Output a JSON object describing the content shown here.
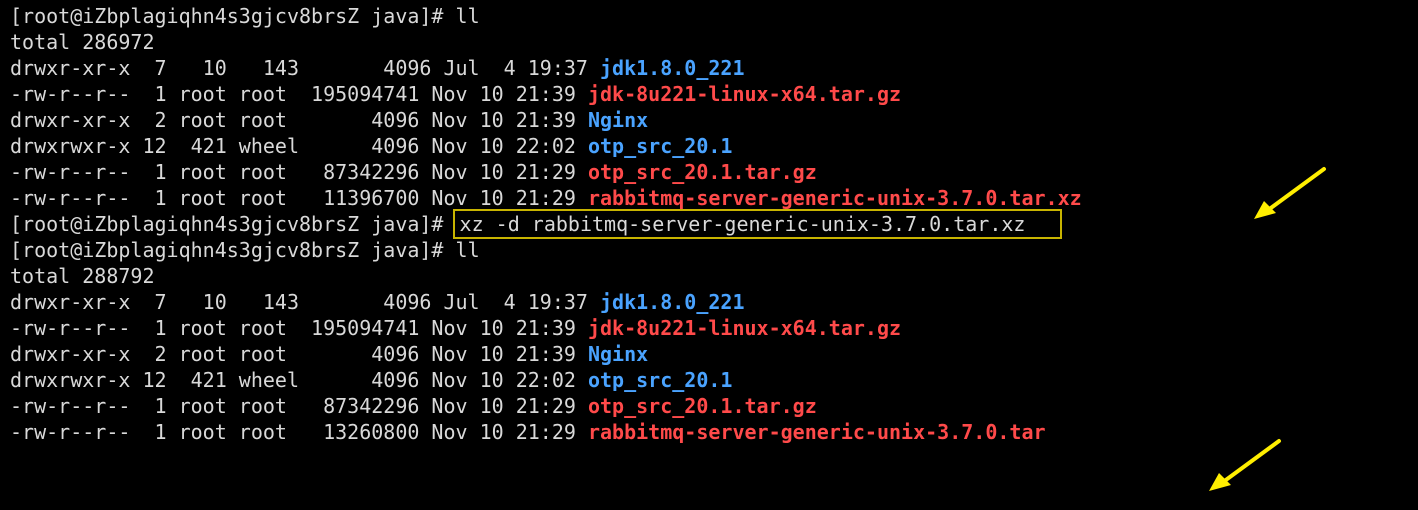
{
  "terminal": {
    "prompt": "[root@iZbplagiqhn4s3gjcv8brsZ java]# ",
    "blocks": [
      {
        "command": "ll",
        "total": "total 286972",
        "rows": [
          {
            "meta": "drwxr-xr-x  7   10   143       4096 Jul  4 19:37 ",
            "name": "jdk1.8.0_221",
            "kind": "dir"
          },
          {
            "meta": "-rw-r--r--  1 root root  195094741 Nov 10 21:39 ",
            "name": "jdk-8u221-linux-x64.tar.gz",
            "kind": "archive"
          },
          {
            "meta": "drwxr-xr-x  2 root root       4096 Nov 10 21:39 ",
            "name": "Nginx",
            "kind": "dir"
          },
          {
            "meta": "drwxrwxr-x 12  421 wheel      4096 Nov 10 22:02 ",
            "name": "otp_src_20.1",
            "kind": "dir"
          },
          {
            "meta": "-rw-r--r--  1 root root   87342296 Nov 10 21:29 ",
            "name": "otp_src_20.1.tar.gz",
            "kind": "archive"
          },
          {
            "meta": "-rw-r--r--  1 root root   11396700 Nov 10 21:29 ",
            "name": "rabbitmq-server-generic-unix-3.7.0.tar.xz",
            "kind": "archive"
          }
        ]
      },
      {
        "command": "xz -d rabbitmq-server-generic-unix-3.7.0.tar.xz",
        "highlighted": true
      },
      {
        "command": "ll",
        "total": "total 288792",
        "rows": [
          {
            "meta": "drwxr-xr-x  7   10   143       4096 Jul  4 19:37 ",
            "name": "jdk1.8.0_221",
            "kind": "dir"
          },
          {
            "meta": "-rw-r--r--  1 root root  195094741 Nov 10 21:39 ",
            "name": "jdk-8u221-linux-x64.tar.gz",
            "kind": "archive"
          },
          {
            "meta": "drwxr-xr-x  2 root root       4096 Nov 10 21:39 ",
            "name": "Nginx",
            "kind": "dir"
          },
          {
            "meta": "drwxrwxr-x 12  421 wheel      4096 Nov 10 22:02 ",
            "name": "otp_src_20.1",
            "kind": "dir"
          },
          {
            "meta": "-rw-r--r--  1 root root   87342296 Nov 10 21:29 ",
            "name": "otp_src_20.1.tar.gz",
            "kind": "archive"
          },
          {
            "meta": "-rw-r--r--  1 root root   13260800 Nov 10 21:29 ",
            "name": "rabbitmq-server-generic-unix-3.7.0.tar",
            "kind": "archive"
          }
        ]
      }
    ],
    "colors": {
      "background": "#000000",
      "text": "#d9d9d9",
      "directory": "#4aa3ff",
      "archive": "#ff4a4a",
      "highlight_box": "#c8b400",
      "arrow": "#ffee00"
    },
    "annotations": [
      {
        "icon": "arrow-icon",
        "points_to": "rabbitmq-server-generic-unix-3.7.0.tar.xz"
      },
      {
        "icon": "arrow-icon",
        "points_to": "rabbitmq-server-generic-unix-3.7.0.tar"
      }
    ]
  }
}
